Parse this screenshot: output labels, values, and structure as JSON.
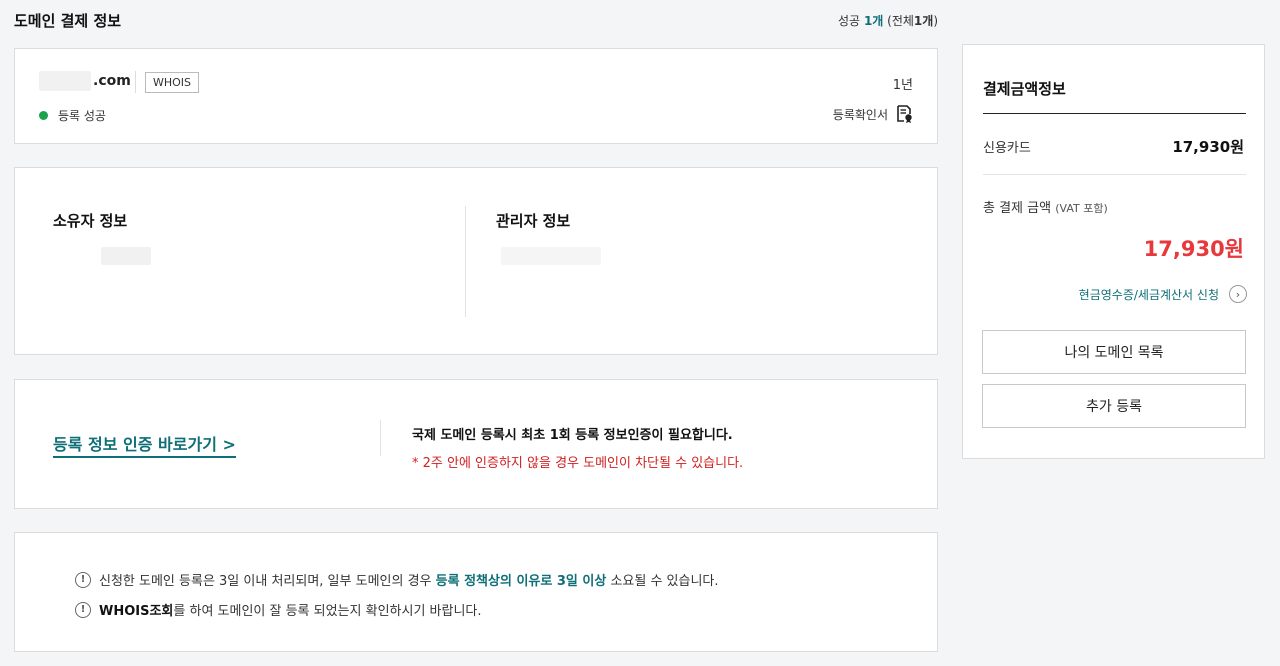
{
  "page": {
    "title": "도메인 결제 정보",
    "count_prefix": "성공",
    "success_count": "1개",
    "total_prefix": "(전체",
    "total_count": "1개",
    "total_suffix": ")"
  },
  "domain_card": {
    "domain_suffix": ".com",
    "whois_label": "WHOIS",
    "period": "1년",
    "status": "등록 성공",
    "certificate_label": "등록확인서",
    "status_color": "#1aa34a"
  },
  "contacts": {
    "owner_title": "소유자 정보",
    "admin_title": "관리자 정보"
  },
  "verify": {
    "link_label": "등록 정보 인증 바로가기 >",
    "notice_main": "국제 도메인 등록시 최초 1회 등록 정보인증이 필요합니다.",
    "notice_warning": "* 2주 안에 인증하지 않을 경우 도메인이 차단될 수 있습니다."
  },
  "info": {
    "line1_pre": "신청한 도메인 등록은 3일 이내 처리되며, 일부 도메인의 경우 ",
    "line1_highlight": "등록 정책상의 이유로 3일 이상",
    "line1_post": " 소요될 수 있습니다.",
    "line2_bold": "WHOIS조회",
    "line2_post": "를 하여 도메인이 잘 등록 되었는지 확인하시기 바랍니다."
  },
  "payment": {
    "title": "결제금액정보",
    "method_label": "신용카드",
    "method_amount": "17,930원",
    "total_label": "총 결제 금액",
    "total_note": "(VAT 포함)",
    "total_amount": "17,930원",
    "receipt_link": "현금영수증/세금계산서 신청",
    "btn_my_domains": "나의 도메인 목록",
    "btn_add": "추가 등록",
    "accent_color": "#0f6f78",
    "total_color": "#e8383b"
  }
}
